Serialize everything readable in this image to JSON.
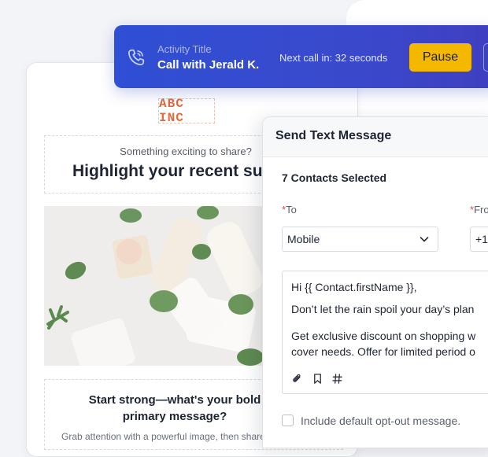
{
  "email_template": {
    "logo": "ABC INC",
    "hero_subtitle": "Something exciting to share?",
    "hero_title": "Highlight your recent success",
    "start_title": "Start strong—what's your bold primary message?",
    "start_body": "Grab attention with a powerful image, then share"
  },
  "activity_bar": {
    "label": "Activity Title",
    "title": "Call with Jerald K.",
    "next_call": "Next call in: 32 seconds",
    "pause_label": "Pause",
    "icon": "phone-icon",
    "accent": "#2f4fd4",
    "pause_color": "#f5b800"
  },
  "sms_panel": {
    "title": "Send Text Message",
    "contacts_selected": "7 Contacts Selected",
    "to_label": "To",
    "from_label": "From",
    "required_mark": "*",
    "to_value": "Mobile",
    "from_value": "+1",
    "message_lines": [
      "Hi {{ Contact.firstName }},",
      "Don’t let the rain spoil your day’s plan",
      "Get exclusive discount on shopping w",
      "cover needs. Offer for limited period o"
    ],
    "toolbar_icons": [
      "paperclip-icon",
      "bookmark-icon",
      "hash-icon"
    ],
    "optout_label": "Include default opt-out message.",
    "optout_checked": false
  }
}
